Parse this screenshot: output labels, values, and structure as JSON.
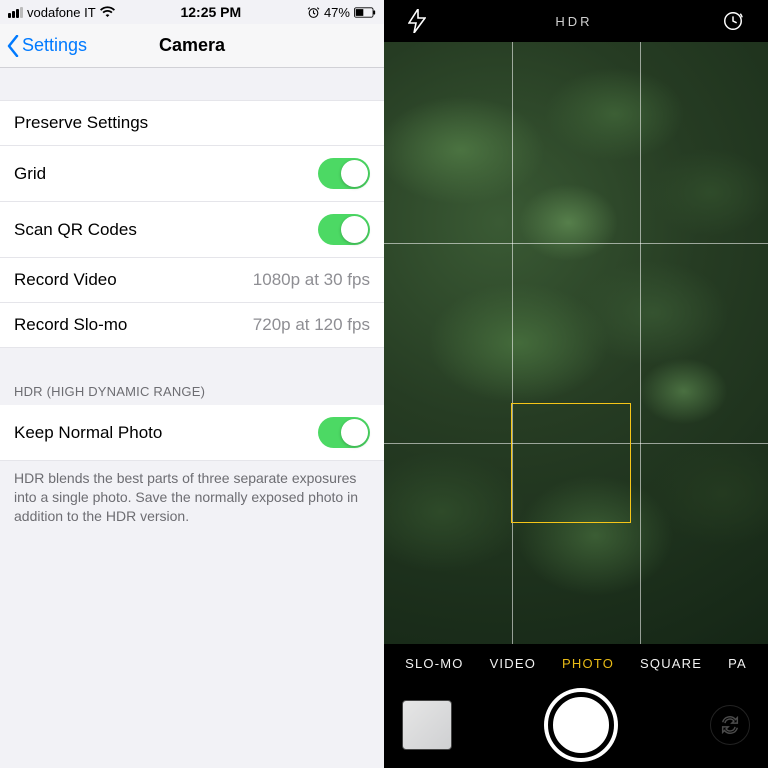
{
  "left": {
    "status": {
      "carrier": "vodafone IT",
      "time": "12:25 PM",
      "battery": "47%"
    },
    "nav": {
      "back": "Settings",
      "title": "Camera"
    },
    "rows": {
      "preserve": "Preserve Settings",
      "grid": "Grid",
      "qr": "Scan QR Codes",
      "record_video_label": "Record Video",
      "record_video_value": "1080p at 30 fps",
      "record_slomo_label": "Record Slo-mo",
      "record_slomo_value": "720p at 120 fps"
    },
    "hdr_header": "HDR (HIGH DYNAMIC RANGE)",
    "keep_normal": "Keep Normal Photo",
    "hdr_footer": "HDR blends the best parts of three separate exposures into a single photo. Save the normally exposed photo in addition to the HDR version."
  },
  "right": {
    "hdr_label": "HDR",
    "modes": {
      "slomo": "SLO-MO",
      "video": "VIDEO",
      "photo": "PHOTO",
      "square": "SQUARE",
      "pano": "PA"
    }
  }
}
